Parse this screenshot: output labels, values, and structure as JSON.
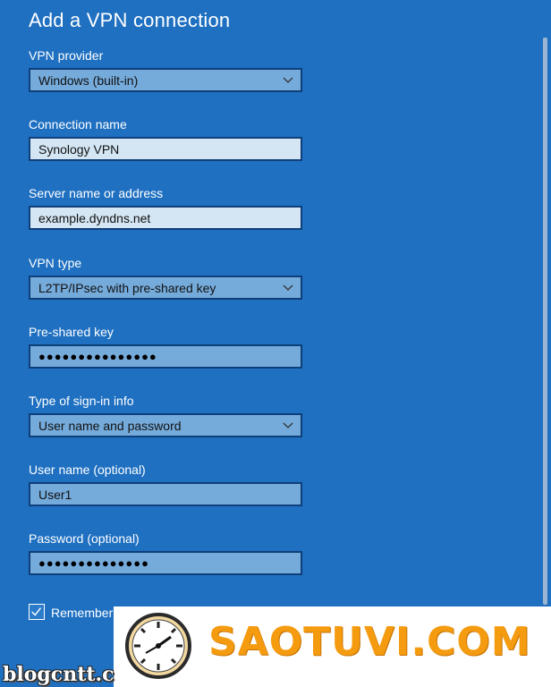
{
  "title": "Add a VPN connection",
  "fields": {
    "vpn_provider": {
      "label": "VPN provider",
      "value": "Windows (built-in)"
    },
    "connection_name": {
      "label": "Connection name",
      "value": "Synology VPN"
    },
    "server_address": {
      "label": "Server name or address",
      "value": "example.dyndns.net"
    },
    "vpn_type": {
      "label": "VPN type",
      "value": "L2TP/IPsec with pre-shared key"
    },
    "pre_shared_key": {
      "label": "Pre-shared key",
      "value": "●●●●●●●●●●●●●●●"
    },
    "sign_in_type": {
      "label": "Type of sign-in info",
      "value": "User name and password"
    },
    "username": {
      "label": "User name (optional)",
      "value": "User1"
    },
    "password": {
      "label": "Password (optional)",
      "value": "●●●●●●●●●●●●●●"
    }
  },
  "remember": {
    "label": "Remember",
    "checked": true
  },
  "banner": {
    "text": "SAOTUVI.COM"
  },
  "watermark": {
    "text": "blogcntt.c"
  },
  "icons": {
    "chevron": "chevron-down-icon",
    "check": "checkmark-icon",
    "clock": "clock-icon"
  },
  "colors": {
    "background": "#1f70c1",
    "select": "#75abdb",
    "input": "#d4e6f4",
    "banner_text": "#f59b10"
  }
}
